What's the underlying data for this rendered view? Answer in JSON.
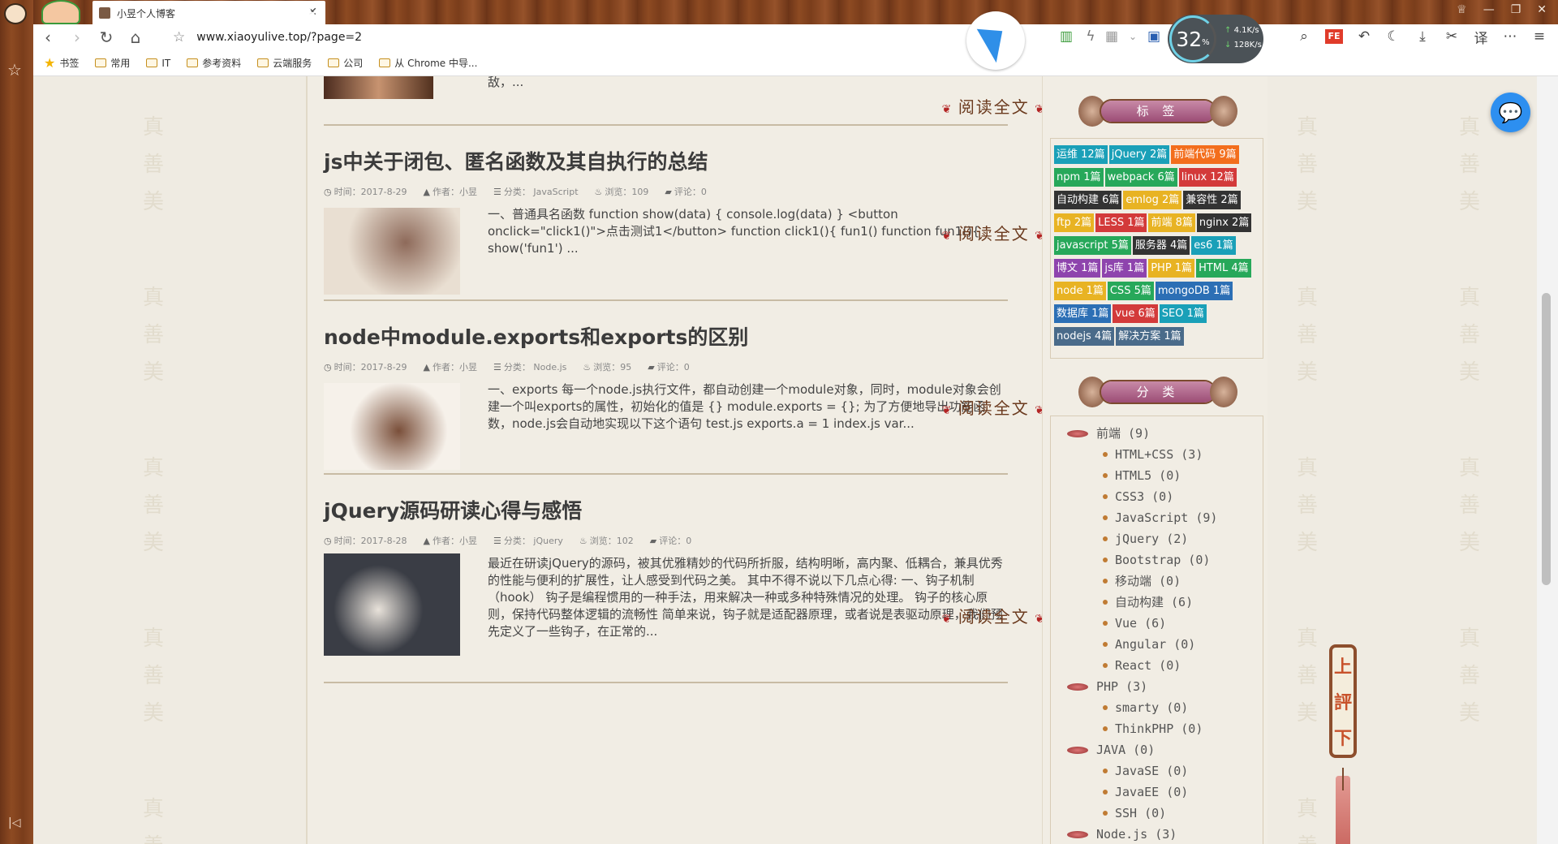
{
  "browser": {
    "tab_title": "小昱个人博客",
    "url": "www.xiaoyulive.top/?page=2",
    "new_tab": "+",
    "bookmarks_label": "书签",
    "bookmarks": [
      "常用",
      "IT",
      "参考资料",
      "云端服务",
      "公司",
      "从 Chrome 中导..."
    ],
    "speed_percent": "32",
    "speed_unit": "%",
    "speed_up": "4.1K/s",
    "speed_down": "128K/s",
    "toolbar_icons": [
      "reading-icon",
      "lightning-icon",
      "grid-icon",
      "chevron-down-icon",
      "screenshot-icon",
      "search-icon",
      "fe-icon",
      "undo-icon",
      "moon-icon",
      "download-icon",
      "scissors-icon",
      "translate-icon",
      "more-icon",
      "menu-icon"
    ],
    "translate_label": "译",
    "fe_label": "FE"
  },
  "articles": [
    {
      "title": "js中关于闭包、匿名函数及其自执行的总结",
      "time": "时间：2017-8-29",
      "author": "作者：小昱",
      "category": "分类：  JavaScript",
      "views": "浏览：109",
      "comments": "评论：0",
      "excerpt": "一、普通具名函数 function show(data) { console.log(data) } <button onclick=\"click1()\">点击测试1</button> function click1(){ fun1() function fun1(){ show('fun1') ...",
      "readmore": "阅读全文"
    },
    {
      "title": "node中module.exports和exports的区别",
      "time": "时间：2017-8-29",
      "author": "作者：小昱",
      "category": "分类：  Node.js",
      "views": "浏览：95",
      "comments": "评论：0",
      "excerpt": "一、exports 每一个node.js执行文件，都自动创建一个module对象，同时，module对象会创建一个叫exports的属性，初始化的值是 {} module.exports = {}; 为了方便地导出功能函数，node.js会自动地实现以下这个语句 test.js exports.a = 1 index.js var...",
      "readmore": "阅读全文"
    },
    {
      "title": "jQuery源码研读心得与感悟",
      "time": "时间：2017-8-28",
      "author": "作者：小昱",
      "category": "分类：  jQuery",
      "views": "浏览：102",
      "comments": "评论：0",
      "excerpt": "最近在研读jQuery的源码，被其优雅精妙的代码所折服，结构明晰，高内聚、低耦合，兼具优秀的性能与便利的扩展性，让人感受到代码之美。 其中不得不说以下几点心得: 一、钩子机制（hook） 钩子是编程惯用的一种手法，用来解决一种或多种特殊情况的处理。 钩子的核心原则，保持代码整体逻辑的流畅性 简单来说，钩子就是适配器原理，或者说是表驱动原理，我们预先定义了一些钩子，在正常的...",
      "readmore": "阅读全文"
    }
  ],
  "top_excerpt_tail": "敌，...",
  "top_readmore": "阅读全文",
  "sidebar": {
    "tags_title": "标 签",
    "cats_title": "分 类",
    "tags": [
      {
        "label": "运维 12篇",
        "color": "#1aa0b8"
      },
      {
        "label": "jQuery 2篇",
        "color": "#1aa0b8"
      },
      {
        "label": "前端代码 9篇",
        "color": "#f36e1d"
      },
      {
        "label": "npm 1篇",
        "color": "#27a85a"
      },
      {
        "label": "webpack 6篇",
        "color": "#27a85a"
      },
      {
        "label": "linux 12篇",
        "color": "#d33a3a"
      },
      {
        "label": "自动构建 6篇",
        "color": "#333333"
      },
      {
        "label": "emlog 2篇",
        "color": "#e8b323"
      },
      {
        "label": "兼容性 2篇",
        "color": "#333333"
      },
      {
        "label": "ftp 2篇",
        "color": "#e8b323"
      },
      {
        "label": "LESS 1篇",
        "color": "#d33a3a"
      },
      {
        "label": "前端 8篇",
        "color": "#e8b323"
      },
      {
        "label": "nginx 2篇",
        "color": "#333333"
      },
      {
        "label": "javascript 5篇",
        "color": "#27a85a"
      },
      {
        "label": "服务器 4篇",
        "color": "#333333"
      },
      {
        "label": "es6 1篇",
        "color": "#1aa0b8"
      },
      {
        "label": "博文 1篇",
        "color": "#8e44ad"
      },
      {
        "label": "js库 1篇",
        "color": "#8e44ad"
      },
      {
        "label": "PHP 1篇",
        "color": "#e8b323"
      },
      {
        "label": "HTML 4篇",
        "color": "#27a85a"
      },
      {
        "label": "node 1篇",
        "color": "#e8b323"
      },
      {
        "label": "CSS 5篇",
        "color": "#27a85a"
      },
      {
        "label": "mongoDB 1篇",
        "color": "#2c6fb5"
      },
      {
        "label": "数据库 1篇",
        "color": "#2c6fb5"
      },
      {
        "label": "vue 6篇",
        "color": "#d33a3a"
      },
      {
        "label": "SEO 1篇",
        "color": "#1aa0b8"
      },
      {
        "label": "nodejs 4篇",
        "color": "#4a6b8a"
      },
      {
        "label": "解决方案 1篇",
        "color": "#4a6b8a"
      }
    ],
    "categories": [
      {
        "label": "前端 (9)",
        "level": "parent"
      },
      {
        "label": "HTML+CSS (3)",
        "level": "child"
      },
      {
        "label": "HTML5 (0)",
        "level": "child"
      },
      {
        "label": "CSS3 (0)",
        "level": "child"
      },
      {
        "label": "JavaScript (9)",
        "level": "child"
      },
      {
        "label": "jQuery (2)",
        "level": "child"
      },
      {
        "label": "Bootstrap (0)",
        "level": "child"
      },
      {
        "label": "移动端 (0)",
        "level": "child"
      },
      {
        "label": "自动构建 (6)",
        "level": "child"
      },
      {
        "label": "Vue (6)",
        "level": "child"
      },
      {
        "label": "Angular (0)",
        "level": "child"
      },
      {
        "label": "React (0)",
        "level": "child"
      },
      {
        "label": "PHP (3)",
        "level": "parent"
      },
      {
        "label": "smarty (0)",
        "level": "child"
      },
      {
        "label": "ThinkPHP (0)",
        "level": "child"
      },
      {
        "label": "JAVA (0)",
        "level": "parent"
      },
      {
        "label": "JavaSE (0)",
        "level": "child"
      },
      {
        "label": "JavaEE (0)",
        "level": "child"
      },
      {
        "label": "SSH (0)",
        "level": "child"
      },
      {
        "label": "Node.js (3)",
        "level": "parent"
      }
    ]
  },
  "scroll_widget": {
    "up": "上",
    "scroll": "評",
    "down": "下"
  }
}
